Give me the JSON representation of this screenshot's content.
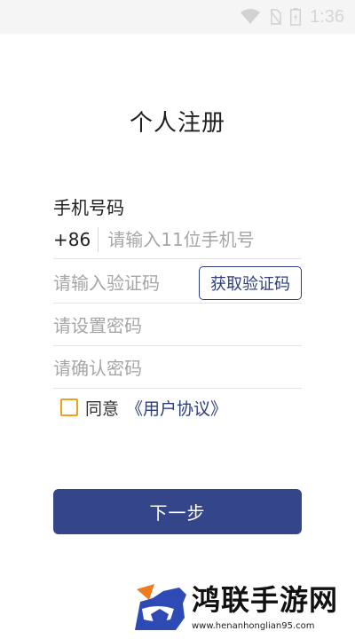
{
  "status_bar": {
    "time": "1:36",
    "icons": [
      "wifi-icon",
      "no-sim-icon",
      "battery-icon"
    ]
  },
  "page": {
    "title": "个人注册"
  },
  "form": {
    "phone_label": "手机号码",
    "country_code": "+86",
    "phone_placeholder": "请输入11位手机号",
    "code_placeholder": "请输入验证码",
    "get_code_label": "获取验证码",
    "password_placeholder": "请设置密码",
    "confirm_password_placeholder": "请确认密码",
    "agree_text": "同意",
    "agreement_link": "《用户协议》",
    "agree_checked": false,
    "next_label": "下一步"
  },
  "watermark": {
    "title": "鸿联手游网",
    "url": "www.henanhonglian95.com"
  },
  "colors": {
    "primary": "#34458a",
    "checkbox": "#f0a020",
    "link": "#2d3e7e"
  }
}
